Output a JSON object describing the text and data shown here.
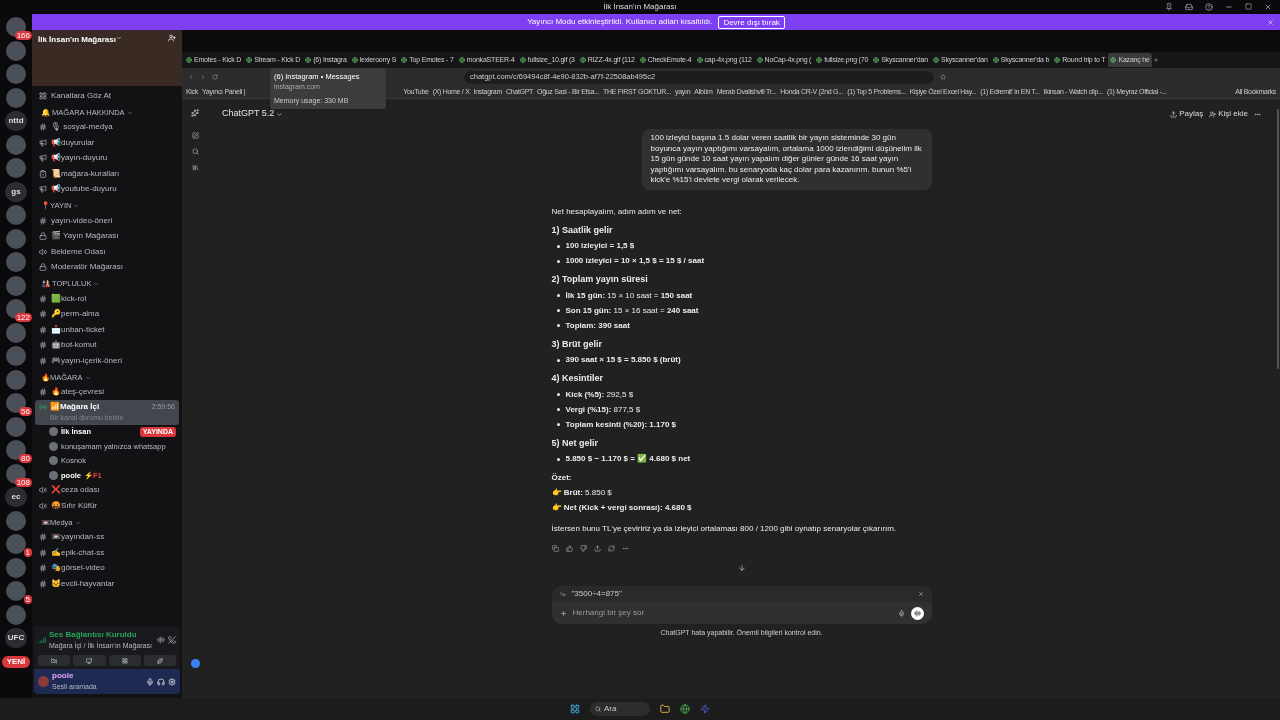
{
  "app_title": "İlk İnsan'ın Mağarası",
  "banner": {
    "text": "Yayıncı Modu etkinleştirildi. Kullanıcı adları kısaltıldı.",
    "button": "Devre dışı bırak"
  },
  "servers": [
    {
      "kind": "image",
      "badge": "166"
    },
    {
      "kind": "image"
    },
    {
      "kind": "image"
    },
    {
      "kind": "image"
    },
    {
      "kind": "text",
      "label": "nttd"
    },
    {
      "kind": "image"
    },
    {
      "kind": "image"
    },
    {
      "kind": "text",
      "label": "gs"
    },
    {
      "kind": "image"
    },
    {
      "kind": "image"
    },
    {
      "kind": "image"
    },
    {
      "kind": "image"
    },
    {
      "kind": "image",
      "badge": "122"
    },
    {
      "kind": "image"
    },
    {
      "kind": "image"
    },
    {
      "kind": "image"
    },
    {
      "kind": "image",
      "badge": "56"
    },
    {
      "kind": "image"
    },
    {
      "kind": "image",
      "badge": "80"
    },
    {
      "kind": "image",
      "badge": "108"
    },
    {
      "kind": "text",
      "label": "ec"
    },
    {
      "kind": "image"
    },
    {
      "kind": "image",
      "badge": "1"
    },
    {
      "kind": "image"
    },
    {
      "kind": "image",
      "badge": "5"
    },
    {
      "kind": "image"
    },
    {
      "kind": "text",
      "label": "UFC"
    },
    {
      "kind": "new",
      "label": "YENİ"
    }
  ],
  "server_name": "İlk İnsan'ın Mağarası",
  "channels": [
    {
      "kind": "browse",
      "name": "Kanallara Göz At",
      "selected": false
    },
    {
      "kind": "category",
      "name": "🔔 MAĞARA HAKKINDA",
      "selected": false
    },
    {
      "kind": "text",
      "name": "🎙 sosyal-medya",
      "selected": false
    },
    {
      "kind": "announce",
      "name": "📢duyurular",
      "selected": false
    },
    {
      "kind": "announce",
      "name": "📢yayın-duyuru",
      "selected": false
    },
    {
      "kind": "rules",
      "name": "📜mağara-kuralları",
      "selected": false
    },
    {
      "kind": "announce",
      "name": "📢youtube-duyuru",
      "selected": false
    },
    {
      "kind": "category",
      "name": "📍YAYIN",
      "selected": false
    },
    {
      "kind": "text",
      "name": "yayın-video-öneri",
      "selected": false
    },
    {
      "kind": "locked",
      "name": "🎬 Yayın Mağarası",
      "selected": false
    },
    {
      "kind": "voice",
      "name": "Bekleme Odası",
      "selected": false
    },
    {
      "kind": "locked",
      "name": "Moderatör Mağarası",
      "selected": false
    },
    {
      "kind": "category",
      "name": "🎎 TOPLULUK",
      "selected": false
    },
    {
      "kind": "text",
      "name": "🟩kick-rol",
      "selected": false
    },
    {
      "kind": "text",
      "name": "🔑perm-alma",
      "selected": false
    },
    {
      "kind": "text",
      "name": "📩unban-ticket",
      "selected": false
    },
    {
      "kind": "text",
      "name": "🤖bot-komut",
      "selected": false
    },
    {
      "kind": "text",
      "name": "🎮yayın-içerik-öneri",
      "selected": false
    },
    {
      "kind": "category",
      "name": "🔥MAĞARA",
      "selected": false
    },
    {
      "kind": "text",
      "name": "🔥ateş-çevresi",
      "selected": false
    },
    {
      "kind": "live",
      "name": "📶Mağara İçi",
      "time": "2:59:56",
      "status": "Bir kanal durumu belirle",
      "selected": true
    },
    {
      "kind": "member",
      "name": "İlk İnsan",
      "badge": "YAYINDA",
      "selected": false
    },
    {
      "kind": "member",
      "name": "konuşamam yalnızca whatsapp",
      "selected": false
    },
    {
      "kind": "member",
      "name": "Kosnok",
      "selected": false
    },
    {
      "kind": "member",
      "name": "poole",
      "extra": "⚡F1",
      "selected": false
    },
    {
      "kind": "voice",
      "name": "❌ceza odası",
      "selected": false
    },
    {
      "kind": "voice",
      "name": "🤬Sıfır Küfür",
      "selected": false
    },
    {
      "kind": "category",
      "name": "📼Medya",
      "selected": false
    },
    {
      "kind": "text",
      "name": "📼yayından-ss",
      "selected": false
    },
    {
      "kind": "text",
      "name": "✍epik-chat-ss",
      "selected": false
    },
    {
      "kind": "text",
      "name": "🎭görsel-video",
      "selected": false
    },
    {
      "kind": "text",
      "name": "🐱evcil-hayvanlar",
      "selected": false
    }
  ],
  "voice_panel": {
    "title": "Ses Bağlantısı Kuruldu",
    "subtitle": "Mağara İçi / İlk İnsan'ın Mağarası"
  },
  "user_panel": {
    "name": "poole",
    "status": "Sesli aramada"
  },
  "browser": {
    "tabs": [
      {
        "label": "Emotes - Kick D",
        "selected": false
      },
      {
        "label": "Stream - Kick D",
        "selected": false
      },
      {
        "label": "(6) Instagra",
        "selected": false
      },
      {
        "label": "lexleroorry S",
        "selected": false
      },
      {
        "label": "Top Emotes - 7",
        "selected": false
      },
      {
        "label": "monkaSTEER-4",
        "selected": false
      },
      {
        "label": "fullsize_10.gif (3",
        "selected": false
      },
      {
        "label": "RIZZ-4x.gif (112",
        "selected": false
      },
      {
        "label": "CheckEmote-4",
        "selected": false
      },
      {
        "label": "cap-4x.png (112",
        "selected": false
      },
      {
        "label": "NoCap-4x.png (",
        "selected": false
      },
      {
        "label": "fullsize.png (70",
        "selected": false
      },
      {
        "label": "Skyscanner'dan",
        "selected": false
      },
      {
        "label": "Skyscanner'dan",
        "selected": false
      },
      {
        "label": "Skyscanner'da b",
        "selected": false
      },
      {
        "label": "Round trip to T",
        "selected": false
      },
      {
        "label": "Kazanç he",
        "selected": true
      }
    ],
    "url": "chatgpt.com/c/69494c8f-4e90-832b-af7f-22508ab495c2",
    "tooltip": {
      "title": "(6) Instagram • Messages",
      "site": "instagram.com",
      "memory": "Memory usage: 330 MB"
    },
    "bookmarks": [
      "Kick",
      "Yayıncı Paneli |",
      "YouTube",
      "(X) Home / X",
      "Instagram",
      "ChatGPT",
      "Oğuz Sasi - Bir Efsa...",
      "THE FIRST GOKTUR...",
      "yayın",
      "Albüm",
      "Merab Dvalishvili Tr...",
      "Honda CR-V (2nd G...",
      "(1) Top 5 Problems...",
      "Kişiye Özel Excel Hay...",
      "(1) Edremit' in EN T...",
      "Ikinsan - Watch clip...",
      "(1) Meyraz Official -..."
    ],
    "all_bookmarks": "All Bookmarks"
  },
  "chat": {
    "model": "ChatGPT 5.2",
    "share": "Paylaş",
    "add_person": "Kişi ekle",
    "user_message": "100 izleyici başına 1.5 dolar veren saatlik bir yayın sisteminde 30 gün boyunca yayın yaptığımı varsayalım, ortalama 1000 izlendiğimi düşünelim ilk 15 gün günde 10 saat yayın yapalım diğer günler günde 16 saat yayın yaptığımı varsayalım. bu senaryoda kaç dolar para kazanırım. bunun %5'i kick'e %15'i devlete vergi olarak verilecek.",
    "intro": "Net hesaplayalım, adım adım ve net:",
    "sections": [
      {
        "heading": "1) Saatlik gelir",
        "bullets": [
          "**100 izleyici = 1,5 $**",
          "**1000 izleyici = 10 × 1,5 $ = 15 $ / saat**"
        ]
      },
      {
        "heading": "2) Toplam yayın süresi",
        "bullets": [
          "**İlk 15 gün:** 15 × 10 saat = **150 saat**",
          "**Son 15 gün:** 15 × 16 saat = **240 saat**",
          "**Toplam: 390 saat**"
        ]
      },
      {
        "heading": "3) Brüt gelir",
        "bullets": [
          "**390 saat × 15 $ = 5.850 $ (brüt)**"
        ]
      },
      {
        "heading": "4) Kesintiler",
        "bullets": [
          "**Kick (%5):** 292,5 $",
          "**Vergi (%15):** 877,5 $",
          "**Toplam kesinti (%20): 1.170 $**"
        ]
      },
      {
        "heading": "5) Net gelir",
        "bullets": [
          "**5.850 $ − 1.170 $ = ✅ 4.680 $ net**"
        ]
      }
    ],
    "summary_title": "Özet:",
    "summary": [
      "👉 **Brüt:** 5.850 $",
      "👉 **Net (Kick + vergi sonrası): 4.680 $**"
    ],
    "closing": "İstersen bunu TL'ye çeviririz ya da izleyici ortalaması 800 / 1200 gibi oynatıp senaryolar çıkarırım.",
    "quote": "\"3500÷4=875\"",
    "placeholder": "Herhangi bir şey sor",
    "disclaimer": "ChatGPT hata yapabilir. Önemli bilgileri kontrol edin."
  },
  "taskbar": {
    "search": "Ara"
  }
}
